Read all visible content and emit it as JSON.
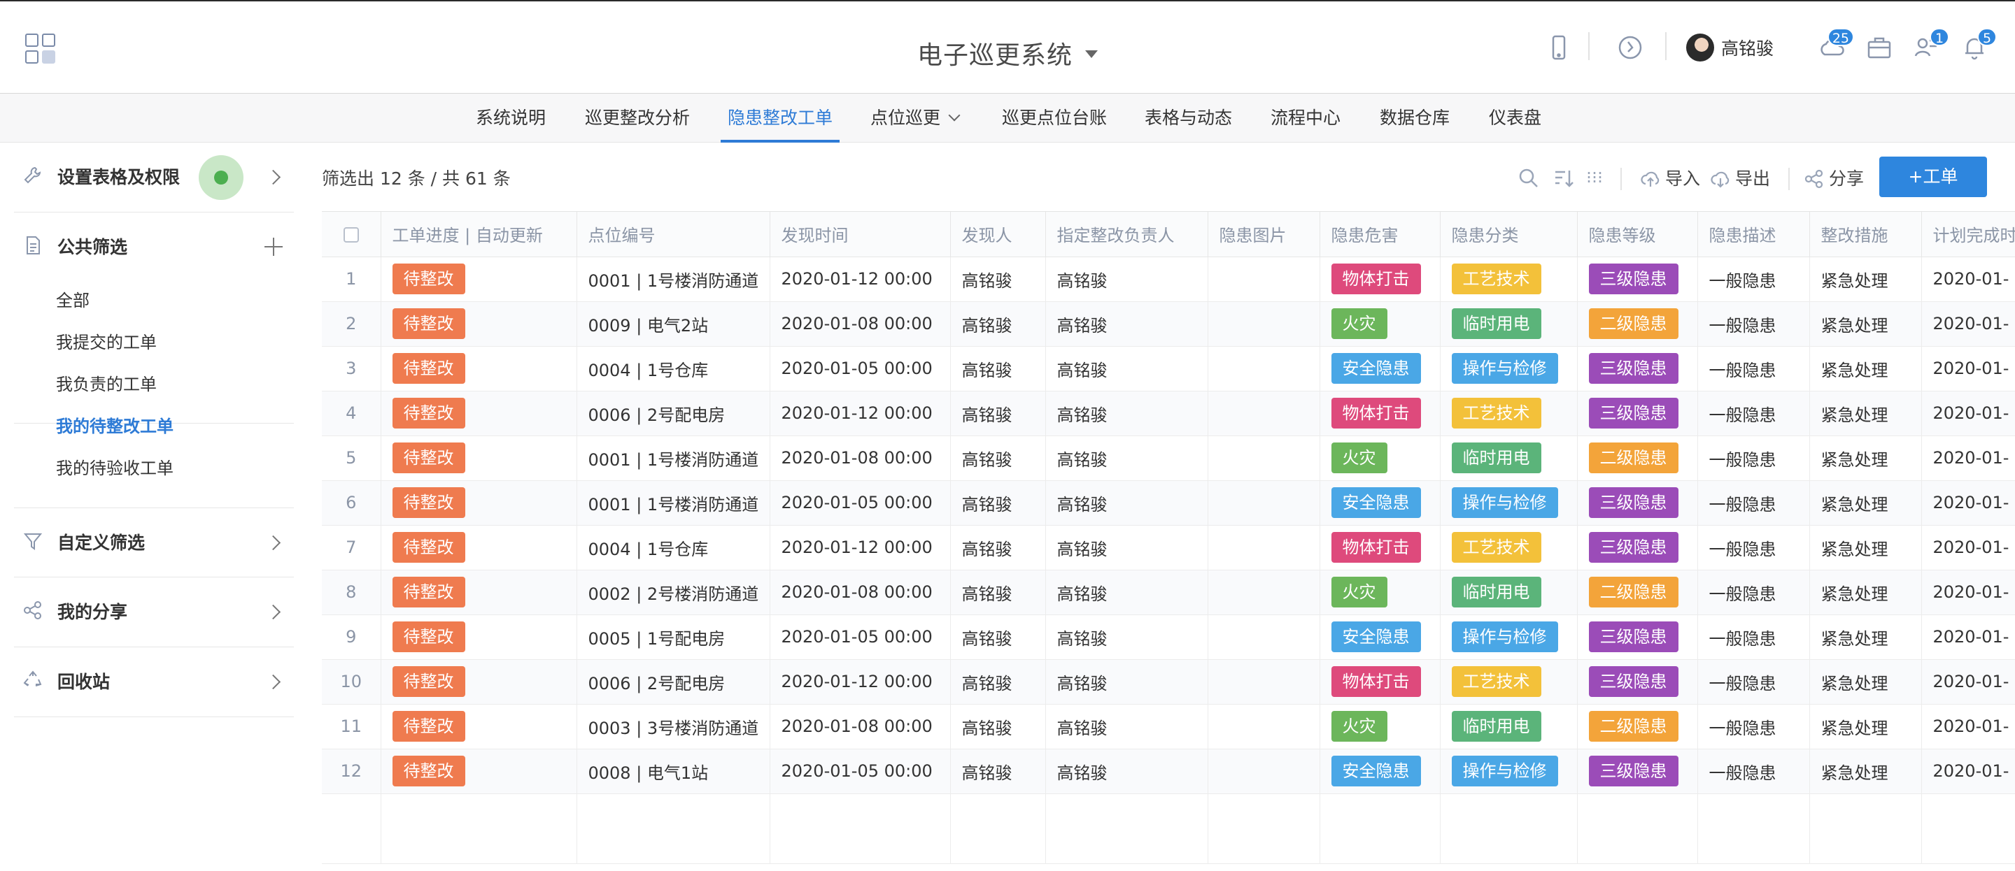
{
  "header": {
    "title": "电子巡更系统",
    "user_name": "高铭骏",
    "badges": {
      "cloud": "25",
      "relation": "1",
      "bell": "5"
    }
  },
  "nav": {
    "tabs": [
      "系统说明",
      "巡更整改分析",
      "隐患整改工单",
      "点位巡更",
      "巡更点位台账",
      "表格与动态",
      "流程中心",
      "数据仓库",
      "仪表盘"
    ],
    "active_index": 2
  },
  "sidebar": {
    "settings_label": "设置表格及权限",
    "public_filter_label": "公共筛选",
    "items": [
      "全部",
      "我提交的工单",
      "我负责的工单",
      "我的待整改工单",
      "我的待验收工单"
    ],
    "active_item": "我的待整改工单",
    "custom_filter_label": "自定义筛选",
    "share_label": "我的分享",
    "recycle_label": "回收站"
  },
  "toolbar": {
    "result_count": "筛选出 12 条 / 共 61 条",
    "import_label": "导入",
    "export_label": "导出",
    "share_label": "分享",
    "new_label": "+工单"
  },
  "table": {
    "columns": [
      "工单进度 | 自动更新",
      "点位编号",
      "发现时间",
      "发现人",
      "指定整改负责人",
      "隐患图片",
      "隐患危害",
      "隐患分类",
      "隐患等级",
      "隐患描述",
      "整改措施",
      "计划完成时"
    ],
    "rows": [
      {
        "idx": "1",
        "status": "待整改",
        "point": "0001 | 1号楼消防通道",
        "time": "2020-01-12 00:00",
        "finder": "高铭骏",
        "owner": "高铭骏",
        "hazard": "物体打击",
        "category": "工艺技术",
        "level": "三级隐患",
        "desc": "一般隐患",
        "measure": "紧急处理",
        "plan": "2020-01-"
      },
      {
        "idx": "2",
        "status": "待整改",
        "point": "0009 | 电气2站",
        "time": "2020-01-08 00:00",
        "finder": "高铭骏",
        "owner": "高铭骏",
        "hazard": "火灾",
        "category": "临时用电",
        "level": "二级隐患",
        "desc": "一般隐患",
        "measure": "紧急处理",
        "plan": "2020-01-"
      },
      {
        "idx": "3",
        "status": "待整改",
        "point": "0004 | 1号仓库",
        "time": "2020-01-05 00:00",
        "finder": "高铭骏",
        "owner": "高铭骏",
        "hazard": "安全隐患",
        "category": "操作与检修",
        "level": "三级隐患",
        "desc": "一般隐患",
        "measure": "紧急处理",
        "plan": "2020-01-"
      },
      {
        "idx": "4",
        "status": "待整改",
        "point": "0006 | 2号配电房",
        "time": "2020-01-12 00:00",
        "finder": "高铭骏",
        "owner": "高铭骏",
        "hazard": "物体打击",
        "category": "工艺技术",
        "level": "三级隐患",
        "desc": "一般隐患",
        "measure": "紧急处理",
        "plan": "2020-01-"
      },
      {
        "idx": "5",
        "status": "待整改",
        "point": "0001 | 1号楼消防通道",
        "time": "2020-01-08 00:00",
        "finder": "高铭骏",
        "owner": "高铭骏",
        "hazard": "火灾",
        "category": "临时用电",
        "level": "二级隐患",
        "desc": "一般隐患",
        "measure": "紧急处理",
        "plan": "2020-01-"
      },
      {
        "idx": "6",
        "status": "待整改",
        "point": "0001 | 1号楼消防通道",
        "time": "2020-01-05 00:00",
        "finder": "高铭骏",
        "owner": "高铭骏",
        "hazard": "安全隐患",
        "category": "操作与检修",
        "level": "三级隐患",
        "desc": "一般隐患",
        "measure": "紧急处理",
        "plan": "2020-01-"
      },
      {
        "idx": "7",
        "status": "待整改",
        "point": "0004 | 1号仓库",
        "time": "2020-01-12 00:00",
        "finder": "高铭骏",
        "owner": "高铭骏",
        "hazard": "物体打击",
        "category": "工艺技术",
        "level": "三级隐患",
        "desc": "一般隐患",
        "measure": "紧急处理",
        "plan": "2020-01-"
      },
      {
        "idx": "8",
        "status": "待整改",
        "point": "0002 | 2号楼消防通道",
        "time": "2020-01-08 00:00",
        "finder": "高铭骏",
        "owner": "高铭骏",
        "hazard": "火灾",
        "category": "临时用电",
        "level": "二级隐患",
        "desc": "一般隐患",
        "measure": "紧急处理",
        "plan": "2020-01-"
      },
      {
        "idx": "9",
        "status": "待整改",
        "point": "0005 | 1号配电房",
        "time": "2020-01-05 00:00",
        "finder": "高铭骏",
        "owner": "高铭骏",
        "hazard": "安全隐患",
        "category": "操作与检修",
        "level": "三级隐患",
        "desc": "一般隐患",
        "measure": "紧急处理",
        "plan": "2020-01-"
      },
      {
        "idx": "10",
        "status": "待整改",
        "point": "0006 | 2号配电房",
        "time": "2020-01-12 00:00",
        "finder": "高铭骏",
        "owner": "高铭骏",
        "hazard": "物体打击",
        "category": "工艺技术",
        "level": "三级隐患",
        "desc": "一般隐患",
        "measure": "紧急处理",
        "plan": "2020-01-"
      },
      {
        "idx": "11",
        "status": "待整改",
        "point": "0003 | 3号楼消防通道",
        "time": "2020-01-08 00:00",
        "finder": "高铭骏",
        "owner": "高铭骏",
        "hazard": "火灾",
        "category": "临时用电",
        "level": "二级隐患",
        "desc": "一般隐患",
        "measure": "紧急处理",
        "plan": "2020-01-"
      },
      {
        "idx": "12",
        "status": "待整改",
        "point": "0008 | 电气1站",
        "time": "2020-01-05 00:00",
        "finder": "高铭骏",
        "owner": "高铭骏",
        "hazard": "安全隐患",
        "category": "操作与检修",
        "level": "三级隐患",
        "desc": "一般隐患",
        "measure": "紧急处理",
        "plan": "2020-01-"
      }
    ]
  },
  "colors": {
    "accent": "#2e86de",
    "status": "#ef7b4f",
    "物体打击": "#de4a7c",
    "火灾": "#6cb65b",
    "安全隐患": "#4aa7e6",
    "工艺技术": "#f3c13a",
    "临时用电": "#5bb47a",
    "操作与检修": "#4aa7e6",
    "三级隐患": "#9b4cb8",
    "二级隐患": "#f3a43a"
  }
}
